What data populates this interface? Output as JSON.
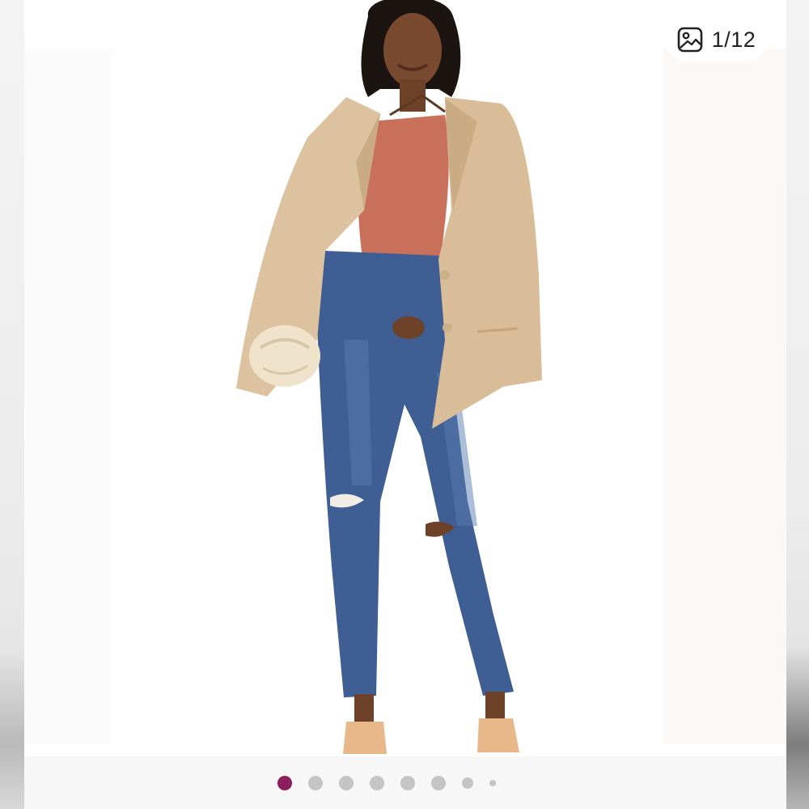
{
  "gallery": {
    "counter_text": "1/12",
    "counter_icon": "image-gallery-icon",
    "current_index": 1,
    "total": 12,
    "dots": [
      {
        "state": "active"
      },
      {
        "state": "default"
      },
      {
        "state": "default"
      },
      {
        "state": "default"
      },
      {
        "state": "default"
      },
      {
        "state": "default"
      },
      {
        "state": "small"
      },
      {
        "state": "tiny"
      }
    ],
    "active_dot_color": "#8a1f5c",
    "inactive_dot_color": "#c4c4c4"
  },
  "photo": {
    "subject": "product-photo"
  }
}
